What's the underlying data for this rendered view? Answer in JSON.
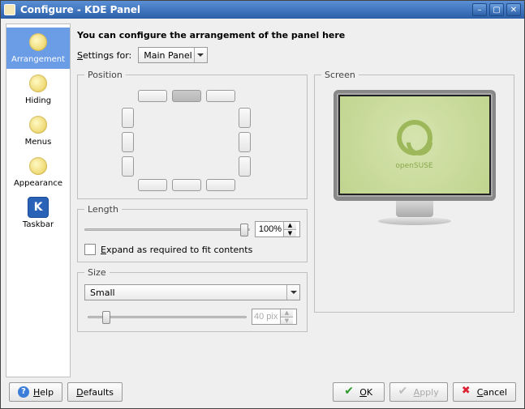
{
  "window": {
    "title": "Configure - KDE Panel"
  },
  "sidebar": {
    "items": [
      {
        "label": "Arrangement"
      },
      {
        "label": "Hiding"
      },
      {
        "label": "Menus"
      },
      {
        "label": "Appearance"
      },
      {
        "label": "Taskbar"
      }
    ]
  },
  "heading": "You can configure the arrangement of the panel here",
  "settings_for_label": "Settings for:",
  "settings_for_value": "Main Panel",
  "position": {
    "legend": "Position"
  },
  "length": {
    "legend": "Length",
    "value": "100%",
    "expand_label": "Expand as required to fit contents"
  },
  "size": {
    "legend": "Size",
    "value": "Small",
    "pixels": "40 pixels"
  },
  "screen": {
    "legend": "Screen",
    "brand": "openSUSE"
  },
  "buttons": {
    "help": "Help",
    "defaults": "Defaults",
    "ok": "OK",
    "apply": "Apply",
    "cancel": "Cancel"
  }
}
